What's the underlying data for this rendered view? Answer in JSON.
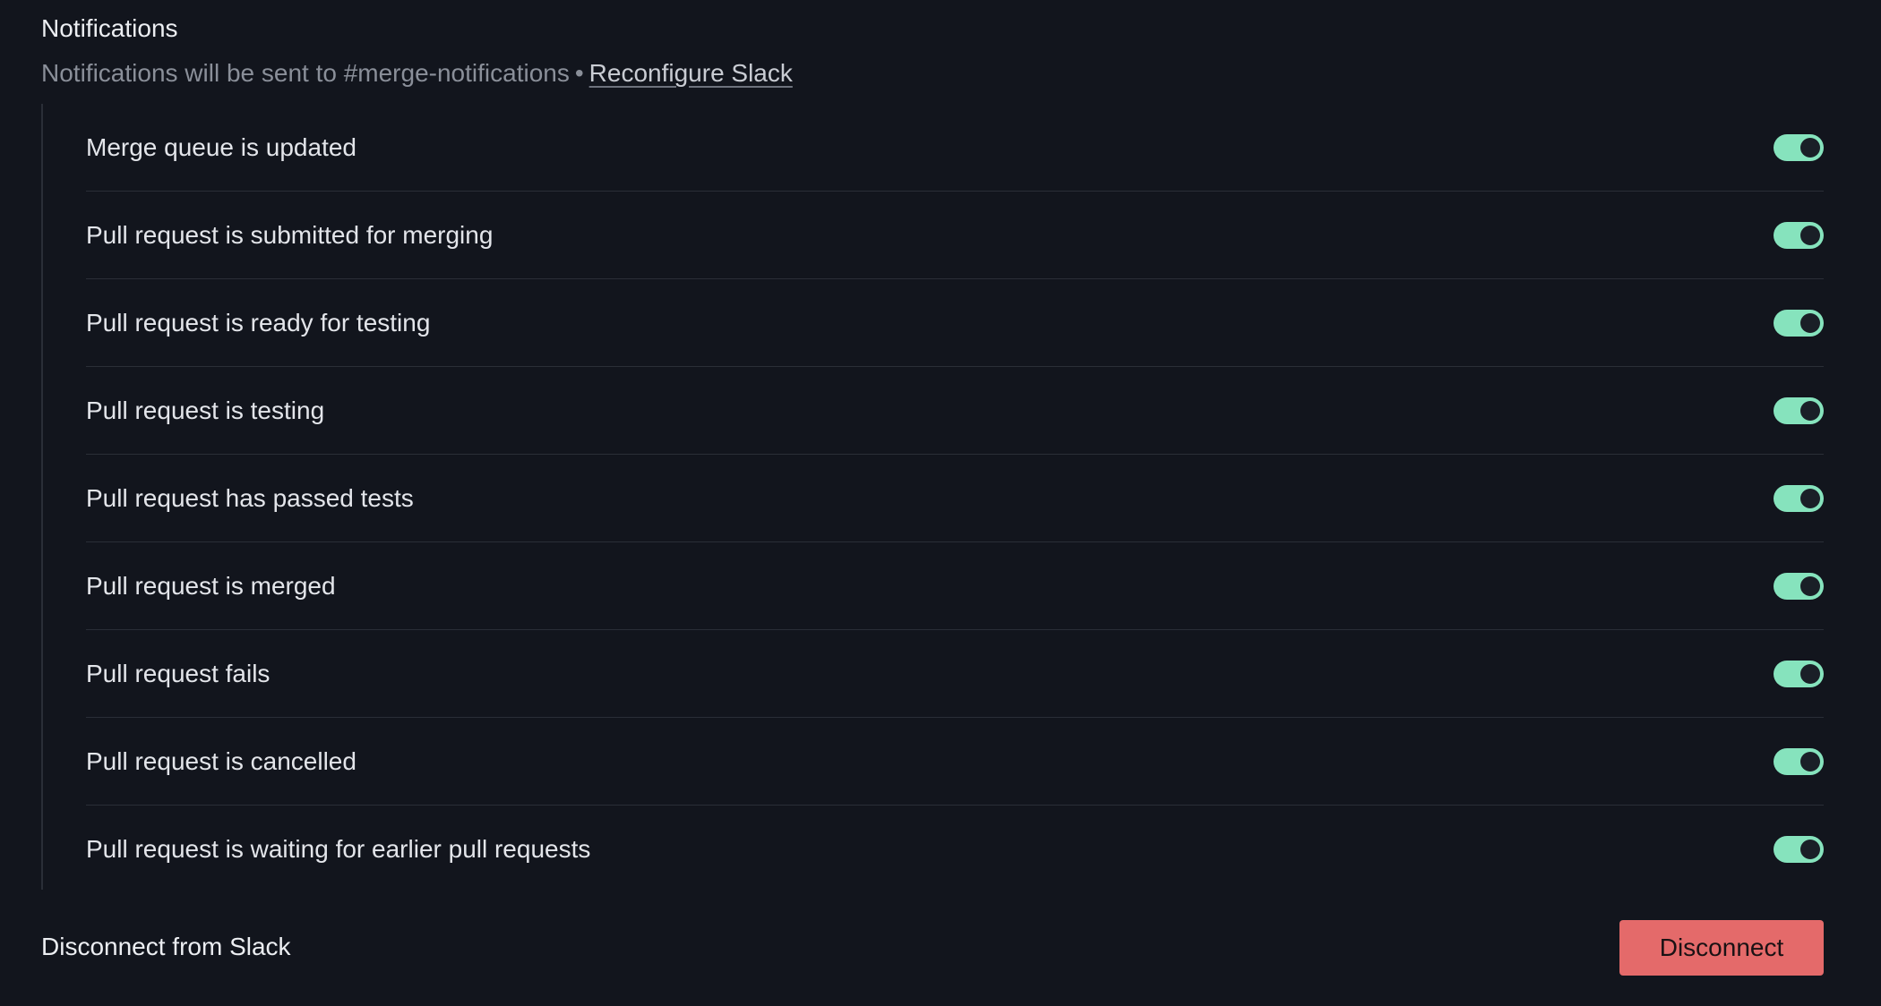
{
  "notifications": {
    "title": "Notifications",
    "subtitle_text": "Notifications will be sent to #merge-notifications",
    "separator": "•",
    "reconfigure_link": "Reconfigure Slack",
    "toggle_color": "#86e3bd",
    "items": [
      {
        "label": "Merge queue is updated",
        "enabled": true
      },
      {
        "label": "Pull request is submitted for merging",
        "enabled": true
      },
      {
        "label": "Pull request is ready for testing",
        "enabled": true
      },
      {
        "label": "Pull request is testing",
        "enabled": true
      },
      {
        "label": "Pull request has passed tests",
        "enabled": true
      },
      {
        "label": "Pull request is merged",
        "enabled": true
      },
      {
        "label": "Pull request fails",
        "enabled": true
      },
      {
        "label": "Pull request is cancelled",
        "enabled": true
      },
      {
        "label": "Pull request is waiting for earlier pull requests",
        "enabled": true
      }
    ]
  },
  "disconnect": {
    "label": "Disconnect from Slack",
    "button_label": "Disconnect",
    "button_color": "#e46a6a"
  }
}
